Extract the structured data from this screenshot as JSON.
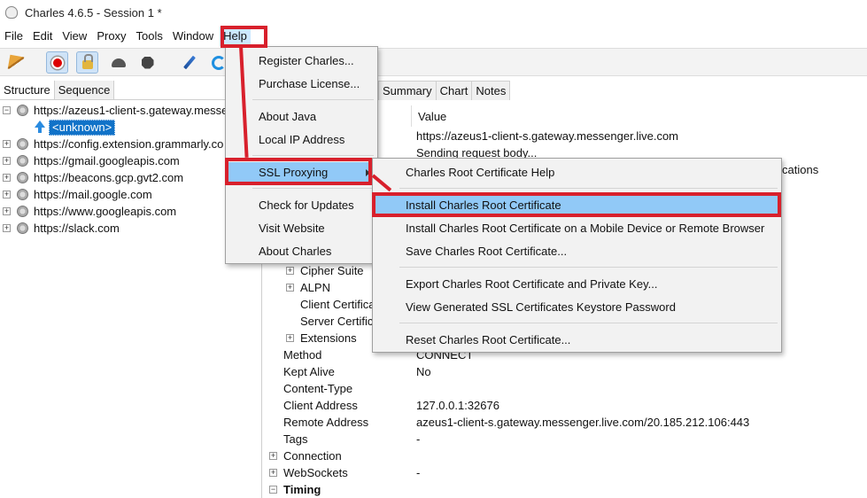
{
  "window": {
    "title": "Charles 4.6.5 - Session 1 *"
  },
  "menubar": {
    "items": [
      "File",
      "Edit",
      "View",
      "Proxy",
      "Tools",
      "Window",
      "Help"
    ]
  },
  "toolbar": {
    "icons": [
      "broom-icon",
      "record-icon",
      "lock-icon",
      "turtle-icon",
      "hexagon-icon",
      "pen-icon",
      "refresh-icon"
    ]
  },
  "left_pane": {
    "tabs": [
      "Structure",
      "Sequence"
    ],
    "selected_tab": "Structure",
    "tree": [
      {
        "label": "https://azeus1-client-s.gateway.messe",
        "expanded": true
      },
      {
        "label": "<unknown>",
        "child": true,
        "selected": true
      },
      {
        "label": "https://config.extension.grammarly.co"
      },
      {
        "label": "https://gmail.googleapis.com"
      },
      {
        "label": "https://beacons.gcp.gvt2.com"
      },
      {
        "label": "https://mail.google.com"
      },
      {
        "label": "https://www.googleapis.com"
      },
      {
        "label": "https://slack.com"
      }
    ]
  },
  "right_pane": {
    "tabs": [
      "Summary",
      "Chart",
      "Notes"
    ],
    "value_header": "Value",
    "rows": [
      {
        "name": "",
        "value": "https://azeus1-client-s.gateway.messenger.live.com"
      },
      {
        "name": "",
        "value": "Sending request body..."
      },
      {
        "name": "",
        "value": "cations"
      },
      {
        "name": "Cipher Suite",
        "value": "",
        "expander": true
      },
      {
        "name": "ALPN",
        "value": "",
        "expander": true
      },
      {
        "name": "Client Certificat",
        "value": ""
      },
      {
        "name": "Server Certific",
        "value": ""
      },
      {
        "name": "Extensions",
        "value": "",
        "expander": true
      },
      {
        "name": "Method",
        "value": "CONNECT"
      },
      {
        "name": "Kept Alive",
        "value": "No"
      },
      {
        "name": "Content-Type",
        "value": ""
      },
      {
        "name": "Client Address",
        "value": "127.0.0.1:32676"
      },
      {
        "name": "Remote Address",
        "value": "azeus1-client-s.gateway.messenger.live.com/20.185.212.106:443"
      },
      {
        "name": "Tags",
        "value": "-"
      },
      {
        "name": "Connection",
        "value": "",
        "expander": true
      },
      {
        "name": "WebSockets",
        "value": "-",
        "expander": true
      },
      {
        "name": "Timing",
        "value": "",
        "expander": true
      }
    ]
  },
  "help_menu": {
    "items": [
      "Register Charles...",
      "Purchase License...",
      "About Java",
      "Local IP Address",
      "SSL Proxying",
      "Check for Updates",
      "Visit Website",
      "About Charles"
    ],
    "highlighted": "SSL Proxying"
  },
  "ssl_submenu": {
    "items": [
      "Charles Root Certificate Help",
      "Install Charles Root Certificate",
      "Install Charles Root Certificate on a Mobile Device or Remote Browser",
      "Save Charles Root Certificate...",
      "Export Charles Root Certificate and Private Key...",
      "View Generated SSL Certificates Keystore Password",
      "Reset Charles Root Certificate..."
    ],
    "highlighted": "Install Charles Root Certificate"
  },
  "colors": {
    "annotation": "#d8202c",
    "menu_highlight": "#91c9f7",
    "selection": "#1072c8"
  }
}
